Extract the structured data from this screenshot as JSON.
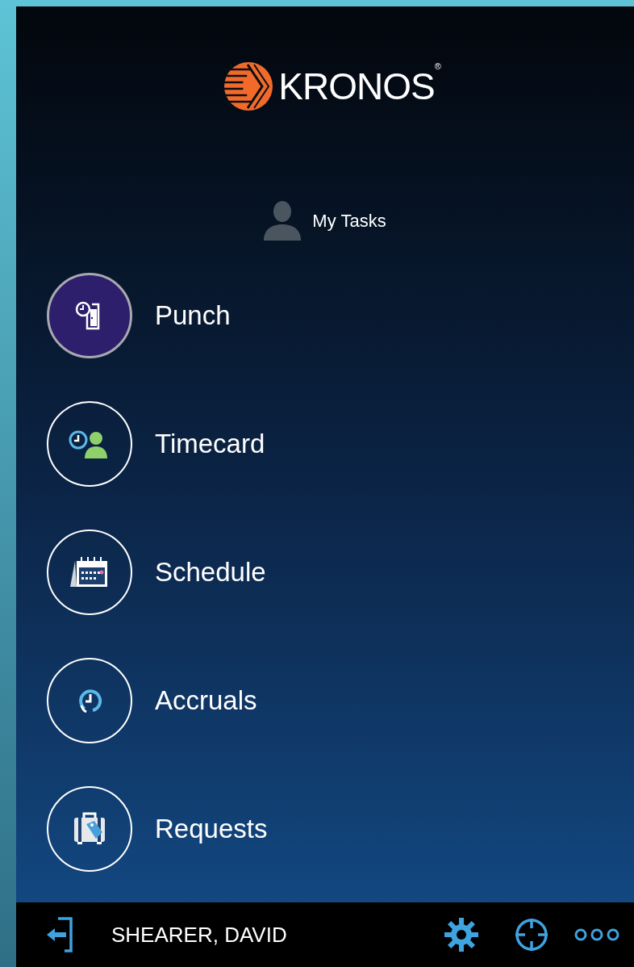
{
  "header": {
    "brand": "KRONOS",
    "registered_mark": "®"
  },
  "section": {
    "title": "My Tasks"
  },
  "tasks": [
    {
      "kind": "punch",
      "label": "Punch",
      "selected": true
    },
    {
      "kind": "timecard",
      "label": "Timecard",
      "selected": false
    },
    {
      "kind": "schedule",
      "label": "Schedule",
      "selected": false
    },
    {
      "kind": "accruals",
      "label": "Accruals",
      "selected": false
    },
    {
      "kind": "requests",
      "label": "Requests",
      "selected": false
    }
  ],
  "footer": {
    "user_name": "SHEARER, DAVID"
  }
}
